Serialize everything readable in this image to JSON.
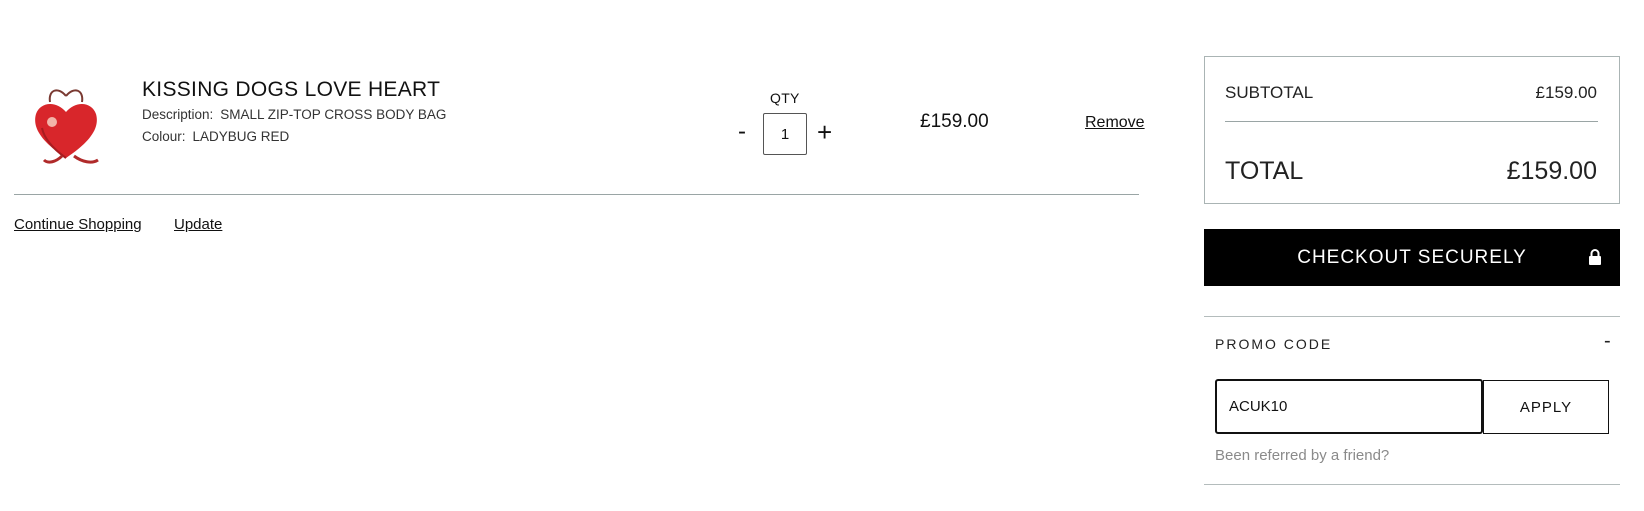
{
  "cart": {
    "item": {
      "name": "KISSING DOGS LOVE HEART",
      "description_label": "Description:",
      "description": "SMALL ZIP-TOP CROSS BODY BAG",
      "colour_label": "Colour:",
      "colour": "LADYBUG RED",
      "qty_label": "QTY",
      "qty_minus": "-",
      "qty": "1",
      "qty_plus": "+",
      "price": "£159.00",
      "remove_label": "Remove",
      "image_icon": "heart-bag-product-icon",
      "image_color": "#d8262b"
    },
    "continue_label": "Continue Shopping",
    "update_label": "Update"
  },
  "summary": {
    "subtotal_label": "SUBTOTAL",
    "subtotal_value": "£159.00",
    "total_label": "TOTAL",
    "total_value": "£159.00"
  },
  "checkout": {
    "label": "CHECKOUT SECURELY",
    "icon": "lock-icon",
    "bg_color": "#000000"
  },
  "promo": {
    "label": "PROMO CODE",
    "toggle": "-",
    "value": "ACUK10",
    "apply_label": "APPLY",
    "referred_label": "Been referred by a friend?"
  }
}
